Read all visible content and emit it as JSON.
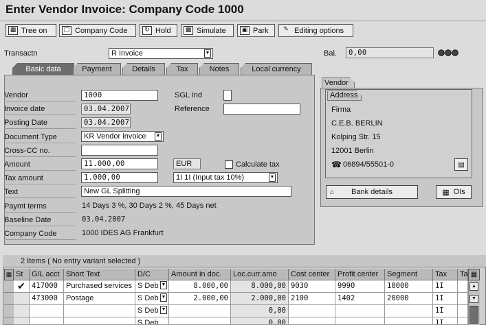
{
  "window": {
    "title": "Enter Vendor Invoice: Company Code 1000"
  },
  "toolbar": {
    "tree_on": "Tree on",
    "company_code": "Company Code",
    "hold": "Hold",
    "simulate": "Simulate",
    "park": "Park",
    "editing_options": "Editing options"
  },
  "header": {
    "transactn_label": "Transactn",
    "transactn_value": "R Invoice",
    "bal_label": "Bal.",
    "bal_value": "0,00"
  },
  "tabs": [
    "Basic data",
    "Payment",
    "Details",
    "Tax",
    "Notes",
    "Local currency"
  ],
  "basic": {
    "vendor_label": "Vendor",
    "vendor_value": "1000",
    "sgl_label": "SGL Ind",
    "sgl_value": "",
    "invoice_date_label": "Invoice date",
    "invoice_date_value": "03.04.2007",
    "reference_label": "Reference",
    "reference_value": "",
    "posting_date_label": "Posting Date",
    "posting_date_value": "03.04.2007",
    "doc_type_label": "Document Type",
    "doc_type_value": "KR Vendor invoice",
    "cross_cc_label": "Cross-CC no.",
    "cross_cc_value": "",
    "amount_label": "Amount",
    "amount_value": "11.000,00",
    "currency": "EUR",
    "calc_tax_label": "Calculate tax",
    "calc_tax_checked": false,
    "tax_amount_label": "Tax amount",
    "tax_amount_value": "1.000,00",
    "tax_code_value": "1I 1I (Input tax 10%)",
    "text_label": "Text",
    "text_value": "New GL Splitting",
    "paymt_terms_label": "Paymt terms",
    "paymt_terms_value": "14 Days 3 %, 30 Days 2 %, 45 Days net",
    "baseline_label": "Baseline Date",
    "baseline_value": "03.04.2007",
    "company_code_label": "Company Code",
    "company_code_value": "1000 IDES AG Frankfurt"
  },
  "vendor_panel": {
    "tab": "Vendor",
    "address_tab": "Address",
    "lines": [
      "Firma",
      "C.E.B. BERLIN",
      "Kolping Str. 15",
      "12001 Berlin"
    ],
    "phone": "06894/55501-0",
    "bank_details": "Bank details",
    "ois": "OIs"
  },
  "items": {
    "summary": "2 Items ( No entry variant selected )",
    "columns": [
      "St",
      "G/L acct",
      "Short Text",
      "D/C",
      "Amount in doc.",
      "Loc.curr.amo",
      "Cost center",
      "Profit center",
      "Segment",
      "Tax",
      "Ta"
    ],
    "rows": [
      {
        "gl": "417000",
        "text": "Purchased services",
        "dc": "S Deb",
        "amount": "8.000,00",
        "loc": "8.000,00",
        "cost": "9030",
        "profit": "9990",
        "segment": "10000",
        "tax": "1I"
      },
      {
        "gl": "473000",
        "text": "Postage",
        "dc": "S Deb",
        "amount": "2.000,00",
        "loc": "2.000,00",
        "cost": "2100",
        "profit": "1402",
        "segment": "20000",
        "tax": "1I"
      },
      {
        "gl": "",
        "text": "",
        "dc": "S Deb",
        "amount": "",
        "loc": "0,00",
        "cost": "",
        "profit": "",
        "segment": "",
        "tax": "1I"
      },
      {
        "gl": "",
        "text": "",
        "dc": "S Deb",
        "amount": "",
        "loc": "0,00",
        "cost": "",
        "profit": "",
        "segment": "",
        "tax": "1I"
      }
    ]
  }
}
